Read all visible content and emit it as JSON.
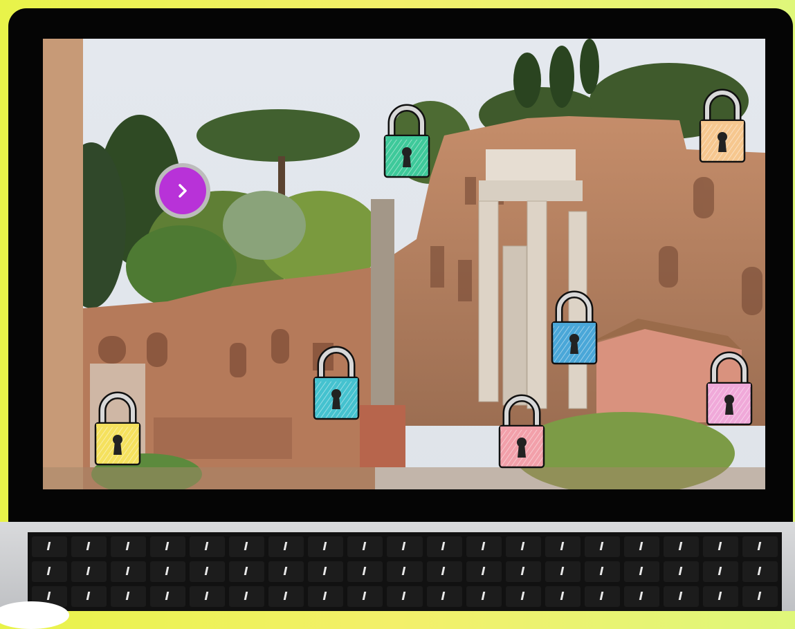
{
  "game": {
    "next_button": {
      "icon": "chevron-right-icon",
      "color": "#b832d8",
      "ring_color": "#bcbcbc"
    },
    "locks": [
      {
        "id": "green",
        "color": "#3ec99a"
      },
      {
        "id": "orange",
        "color": "#f6c78f"
      },
      {
        "id": "blue",
        "color": "#4aa7d8"
      },
      {
        "id": "teal",
        "color": "#45c2cf"
      },
      {
        "id": "yellow",
        "color": "#f5e15e"
      },
      {
        "id": "red",
        "color": "#f2a0aa"
      },
      {
        "id": "pink",
        "color": "#f0a9d9"
      }
    ]
  }
}
